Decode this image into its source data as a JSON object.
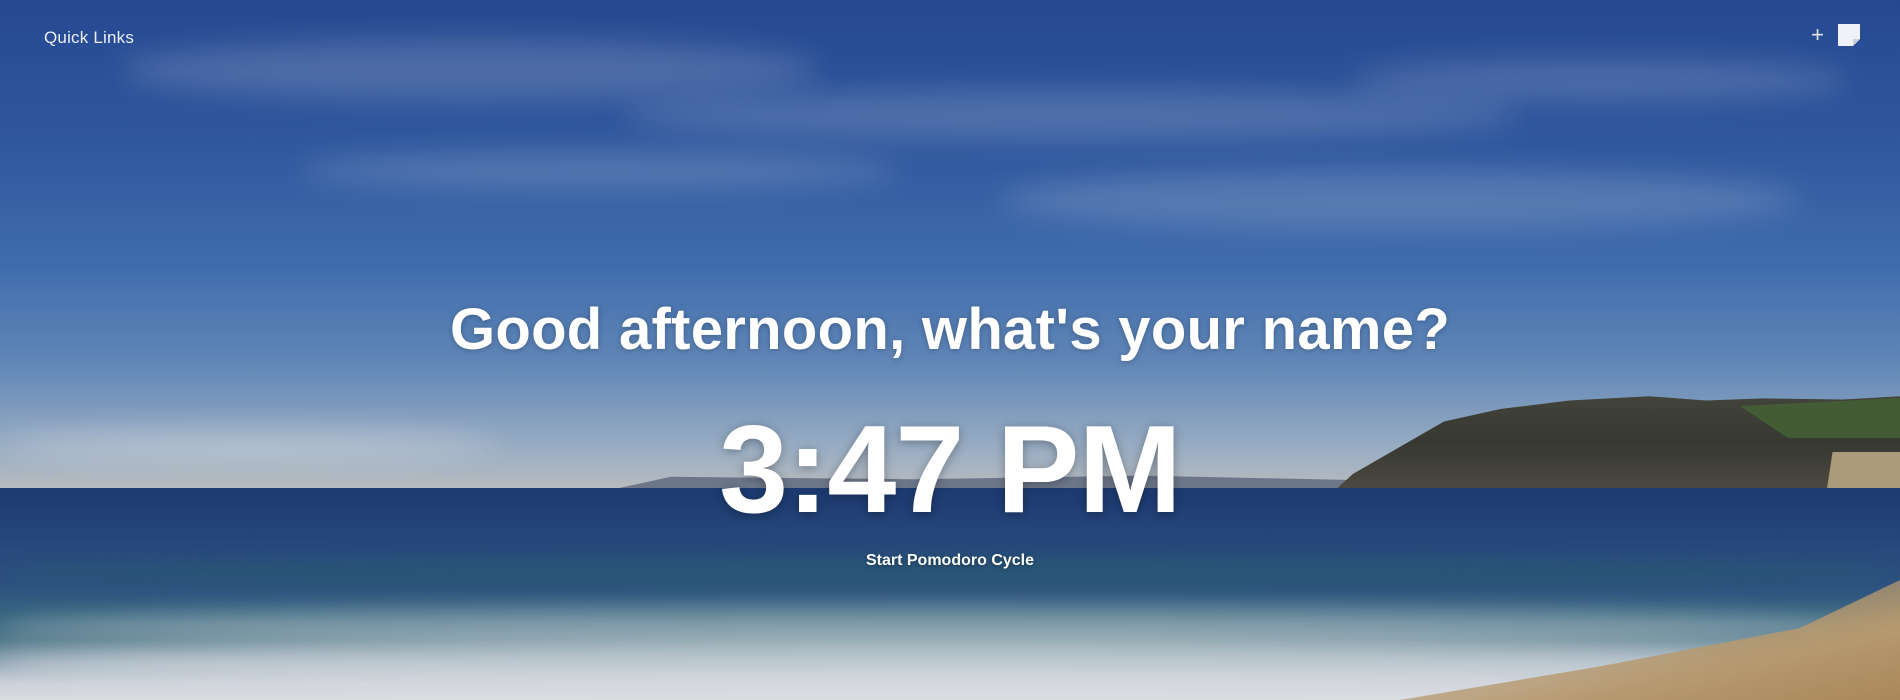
{
  "header": {
    "quick_links_label": "Quick Links"
  },
  "icons": {
    "add": "plus-icon",
    "notes": "sticky-note-icon"
  },
  "greeting": {
    "text": "Good afternoon, what's your",
    "name_prompt": "name?"
  },
  "clock": {
    "time": "3:47 PM"
  },
  "pomodoro": {
    "label": "Start Pomodoro Cycle"
  },
  "colors": {
    "text": "#ffffff",
    "sky": "#3460ad",
    "sea": "#2a4e86",
    "sand": "#c6a678"
  }
}
